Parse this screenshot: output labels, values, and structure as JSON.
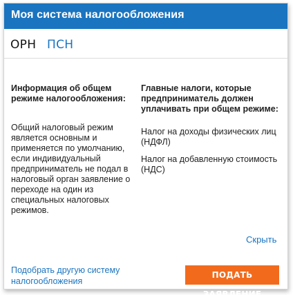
{
  "header": {
    "title": "Моя система налогообложения"
  },
  "tabs": [
    {
      "label": "ОРН",
      "active": true
    },
    {
      "label": "ПСН",
      "active": false
    }
  ],
  "left_column": {
    "heading": "Информация об общем режиме налогообложения:",
    "text": "Общий налоговый режим является основным и применяется по умолчанию, если индивидуальный предприниматель не подал в налоговый орган заявление о переходе на один из специальных налоговых режимов."
  },
  "right_column": {
    "heading": "Главные налоги, которые предприниматель должен уплачивать при общем режиме:",
    "items": [
      "Налог на доходы физических лиц (НДФЛ)",
      "Налог на добавленную стоимость (НДС)"
    ]
  },
  "links": {
    "hide": "Скрыть",
    "other_system": "Подобрать другую систему налогообложения"
  },
  "buttons": {
    "submit": "ПОДАТЬ ЗАЯВЛЕНИЕ"
  },
  "colors": {
    "header_bg": "#1a74c0",
    "link": "#1a74c0",
    "button_bg": "#f26b1d"
  }
}
